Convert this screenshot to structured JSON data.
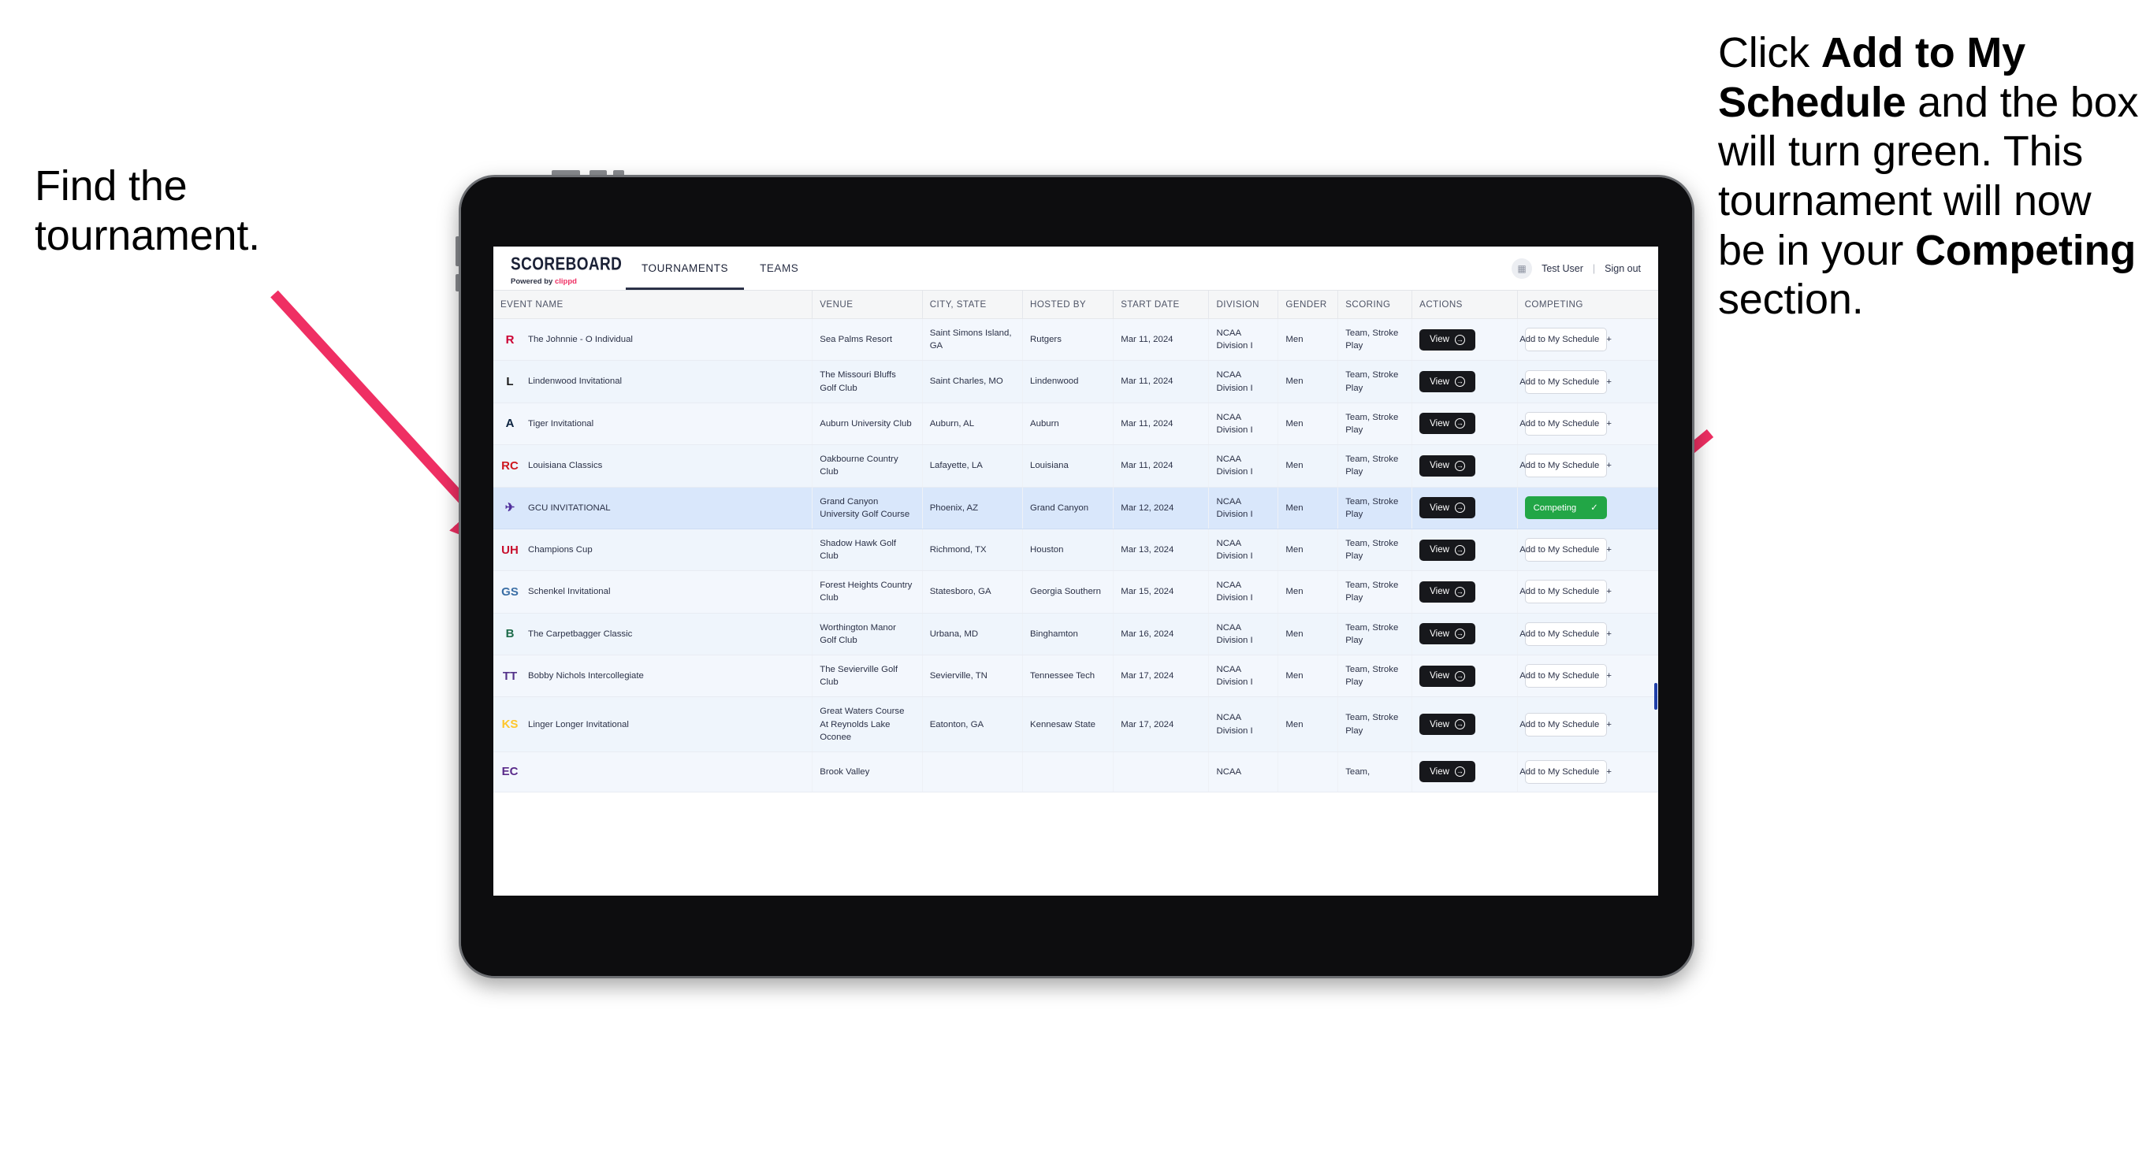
{
  "annotations": {
    "left": {
      "line1": "Find the",
      "line2": "tournament."
    },
    "right": {
      "pre": "Click ",
      "bold1": "Add to My Schedule",
      "mid": " and the box will turn green. This tournament will now be in your ",
      "bold2": "Competing",
      "post": " section."
    }
  },
  "app": {
    "brand_name": "SCOREBOARD",
    "brand_powered_prefix": "Powered by ",
    "brand_powered_name": "clippd",
    "nav": [
      {
        "label": "TOURNAMENTS",
        "active": true
      },
      {
        "label": "TEAMS",
        "active": false
      }
    ],
    "account": {
      "avatar_icon": "grid-icon",
      "user_name": "Test User",
      "separator": "|",
      "sign_out": "Sign out"
    }
  },
  "table": {
    "columns": [
      "EVENT NAME",
      "VENUE",
      "CITY, STATE",
      "HOSTED BY",
      "START DATE",
      "DIVISION",
      "GENDER",
      "SCORING",
      "ACTIONS",
      "COMPETING"
    ],
    "action_label": "View",
    "add_label": "Add to My Schedule",
    "add_icon": "plus-icon",
    "competing_label": "Competing",
    "competing_icon": "check-icon",
    "competing_color": "#22a646",
    "rows": [
      {
        "logo_text": "R",
        "logo_color": "#cc0033",
        "logo_bg": "transparent",
        "event": "The Johnnie - O Individual",
        "venue": "Sea Palms Resort",
        "city": "Saint Simons Island, GA",
        "host": "Rutgers",
        "date": "Mar 11, 2024",
        "division": "NCAA Division I",
        "gender": "Men",
        "scoring": "Team, Stroke Play",
        "competing": false
      },
      {
        "logo_text": "L",
        "logo_color": "#1a1a1a",
        "logo_bg": "transparent",
        "event": "Lindenwood Invitational",
        "venue": "The Missouri Bluffs Golf Club",
        "city": "Saint Charles, MO",
        "host": "Lindenwood",
        "date": "Mar 11, 2024",
        "division": "NCAA Division I",
        "gender": "Men",
        "scoring": "Team, Stroke Play",
        "competing": false
      },
      {
        "logo_text": "A",
        "logo_color": "#0c2340",
        "logo_bg": "transparent",
        "event": "Tiger Invitational",
        "venue": "Auburn University Club",
        "city": "Auburn, AL",
        "host": "Auburn",
        "date": "Mar 11, 2024",
        "division": "NCAA Division I",
        "gender": "Men",
        "scoring": "Team, Stroke Play",
        "competing": false
      },
      {
        "logo_text": "RC",
        "logo_color": "#ce181e",
        "logo_bg": "transparent",
        "event": "Louisiana Classics",
        "venue": "Oakbourne Country Club",
        "city": "Lafayette, LA",
        "host": "Louisiana",
        "date": "Mar 11, 2024",
        "division": "NCAA Division I",
        "gender": "Men",
        "scoring": "Team, Stroke Play",
        "competing": false
      },
      {
        "logo_text": "✈",
        "logo_color": "#4f2d9c",
        "logo_bg": "transparent",
        "event": "GCU INVITATIONAL",
        "venue": "Grand Canyon University Golf Course",
        "city": "Phoenix, AZ",
        "host": "Grand Canyon",
        "date": "Mar 12, 2024",
        "division": "NCAA Division I",
        "gender": "Men",
        "scoring": "Team, Stroke Play",
        "competing": true
      },
      {
        "logo_text": "UH",
        "logo_color": "#c8102e",
        "logo_bg": "transparent",
        "event": "Champions Cup",
        "venue": "Shadow Hawk Golf Club",
        "city": "Richmond, TX",
        "host": "Houston",
        "date": "Mar 13, 2024",
        "division": "NCAA Division I",
        "gender": "Men",
        "scoring": "Team, Stroke Play",
        "competing": false
      },
      {
        "logo_text": "GS",
        "logo_color": "#3a6ea5",
        "logo_bg": "transparent",
        "event": "Schenkel Invitational",
        "venue": "Forest Heights Country Club",
        "city": "Statesboro, GA",
        "host": "Georgia Southern",
        "date": "Mar 15, 2024",
        "division": "NCAA Division I",
        "gender": "Men",
        "scoring": "Team, Stroke Play",
        "competing": false
      },
      {
        "logo_text": "B",
        "logo_color": "#1d6b4a",
        "logo_bg": "transparent",
        "event": "The Carpetbagger Classic",
        "venue": "Worthington Manor Golf Club",
        "city": "Urbana, MD",
        "host": "Binghamton",
        "date": "Mar 16, 2024",
        "division": "NCAA Division I",
        "gender": "Men",
        "scoring": "Team, Stroke Play",
        "competing": false
      },
      {
        "logo_text": "TT",
        "logo_color": "#54338a",
        "logo_bg": "transparent",
        "event": "Bobby Nichols Intercollegiate",
        "venue": "The Sevierville Golf Club",
        "city": "Sevierville, TN",
        "host": "Tennessee Tech",
        "date": "Mar 17, 2024",
        "division": "NCAA Division I",
        "gender": "Men",
        "scoring": "Team, Stroke Play",
        "competing": false
      },
      {
        "logo_text": "KS",
        "logo_color": "#ffc629",
        "logo_bg": "transparent",
        "event": "Linger Longer Invitational",
        "venue": "Great Waters Course At Reynolds Lake Oconee",
        "city": "Eatonton, GA",
        "host": "Kennesaw State",
        "date": "Mar 17, 2024",
        "division": "NCAA Division I",
        "gender": "Men",
        "scoring": "Team, Stroke Play",
        "competing": false
      },
      {
        "logo_text": "EC",
        "logo_color": "#592a8a",
        "logo_bg": "transparent",
        "event": "",
        "venue": "Brook Valley",
        "city": "",
        "host": "",
        "date": "",
        "division": "NCAA",
        "gender": "",
        "scoring": "Team,",
        "competing": false,
        "partial": true
      }
    ]
  }
}
